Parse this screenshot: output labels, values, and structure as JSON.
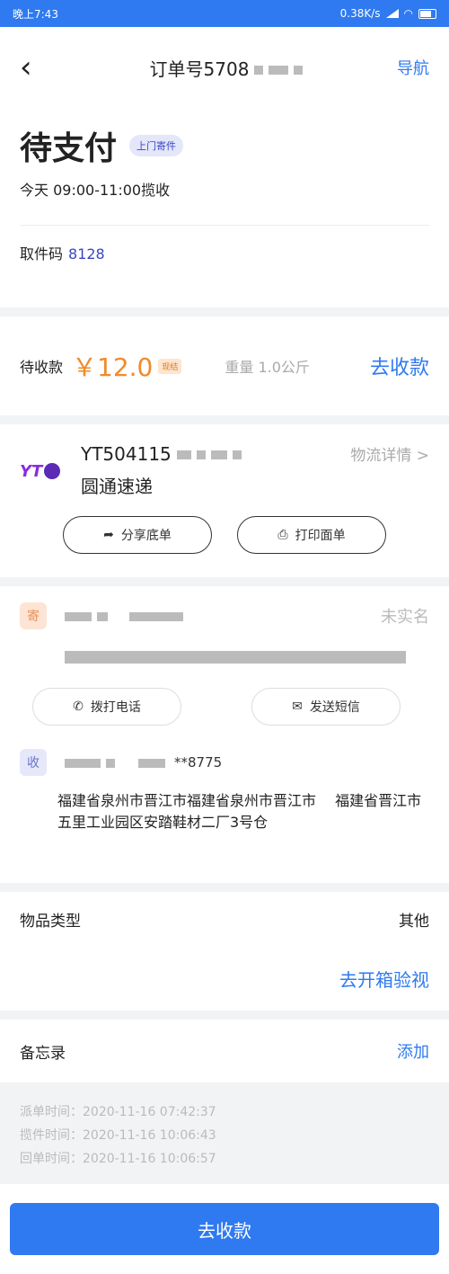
{
  "status_bar": {
    "time": "晚上7:43",
    "net": "0.38K/s"
  },
  "header": {
    "title": "订单号5708",
    "nav_label": "导航"
  },
  "order": {
    "status": "待支付",
    "badge": "上门寄件",
    "pickup_time": "今天 09:00-11:00揽收",
    "code_label": "取件码",
    "code_value": "8128"
  },
  "payment": {
    "label": "待收款",
    "amount": "￥12.0",
    "amount_tag": "现结",
    "weight": "重量 1.0公斤",
    "collect_label": "去收款"
  },
  "courier": {
    "tracking": "YT504115",
    "company": "圆通速递",
    "logistics_label": "物流详情 >",
    "share_label": "分享底单",
    "print_label": "打印面单"
  },
  "sender": {
    "role": "寄",
    "verified_status": "未实名",
    "call_label": "拨打电话",
    "sms_label": "发送短信"
  },
  "receiver": {
    "role": "收",
    "phone": "**8775",
    "address": "福建省泉州市晋江市福建省泉州市晋江市　 福建省晋江市五里工业园区安踏鞋材二厂3号仓"
  },
  "goods": {
    "type_label": "物品类型",
    "type_value": "其他",
    "open_check_label": "去开箱验视"
  },
  "memo": {
    "label": "备忘录",
    "add_label": "添加"
  },
  "times": {
    "order_time": "派单时间：2020-11-16 07:42:37",
    "pickup_time": "揽件时间：2020-11-16 10:06:43",
    "return_time": "回单时间：2020-11-16 10:06:57"
  },
  "bottom": {
    "primary_label": "去收款"
  },
  "colors": {
    "accent": "#2f7af0",
    "price": "#f08a2c",
    "badge_text": "#3847c6"
  }
}
